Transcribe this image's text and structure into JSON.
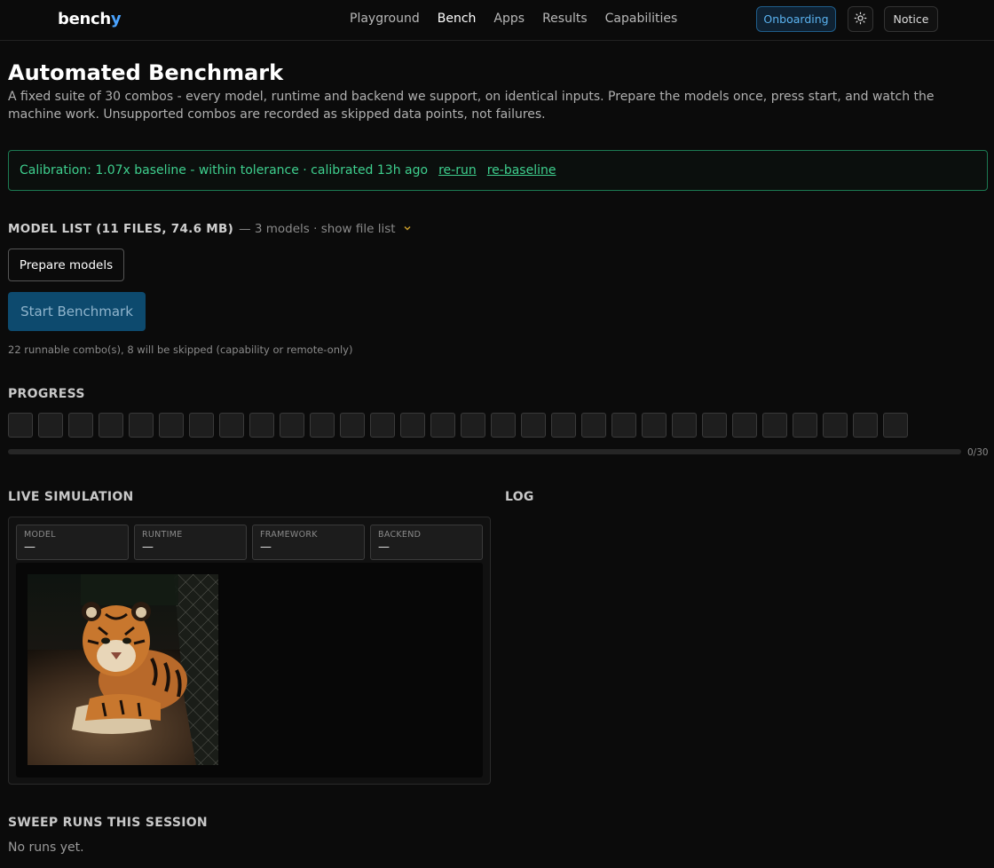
{
  "nav": {
    "brand_main": "bench",
    "brand_accent": "y",
    "links": [
      {
        "label": "Playground",
        "active": false
      },
      {
        "label": "Bench",
        "active": true
      },
      {
        "label": "Apps",
        "active": false
      },
      {
        "label": "Results",
        "active": false
      },
      {
        "label": "Capabilities",
        "active": false
      }
    ],
    "onboarding_label": "Onboarding",
    "theme_icon": "sun-icon",
    "notice_label": "Notice"
  },
  "page": {
    "title": "Automated Benchmark",
    "description": "A fixed suite of 30 combos - every model, runtime and backend we support, on identical inputs. Prepare the models once, press start, and watch the machine work. Unsupported combos are recorded as skipped data points, not failures."
  },
  "calibration": {
    "text": "Calibration: 1.07x baseline - within tolerance · calibrated 13h ago",
    "rerun_link": "re-run",
    "rebaseline_link": "re-baseline",
    "color": "#3ecf8e"
  },
  "model_list": {
    "title": "MODEL LIST (11 FILES, 74.6 MB)",
    "subtitle": "— 3 models · show file list",
    "chevron_icon": "chevron-down-icon"
  },
  "actions": {
    "prepare_label": "Prepare models",
    "start_label": "Start Benchmark",
    "runnable_note": "22 runnable combo(s), 8 will be skipped (capability or remote-only)"
  },
  "progress": {
    "heading": "PROGRESS",
    "total": 30,
    "done": 0,
    "fraction": 0,
    "count_label": "0/30"
  },
  "simulation": {
    "heading": "LIVE SIMULATION",
    "fields": [
      {
        "label": "MODEL",
        "value": "—"
      },
      {
        "label": "RUNTIME",
        "value": "—"
      },
      {
        "label": "FRAMEWORK",
        "value": "—"
      },
      {
        "label": "BACKEND",
        "value": "—"
      }
    ],
    "image_subject": "tiger-cub-photo"
  },
  "log": {
    "heading": "LOG"
  },
  "sweep": {
    "heading": "SWEEP RUNS THIS SESSION",
    "empty_text": "No runs yet."
  }
}
